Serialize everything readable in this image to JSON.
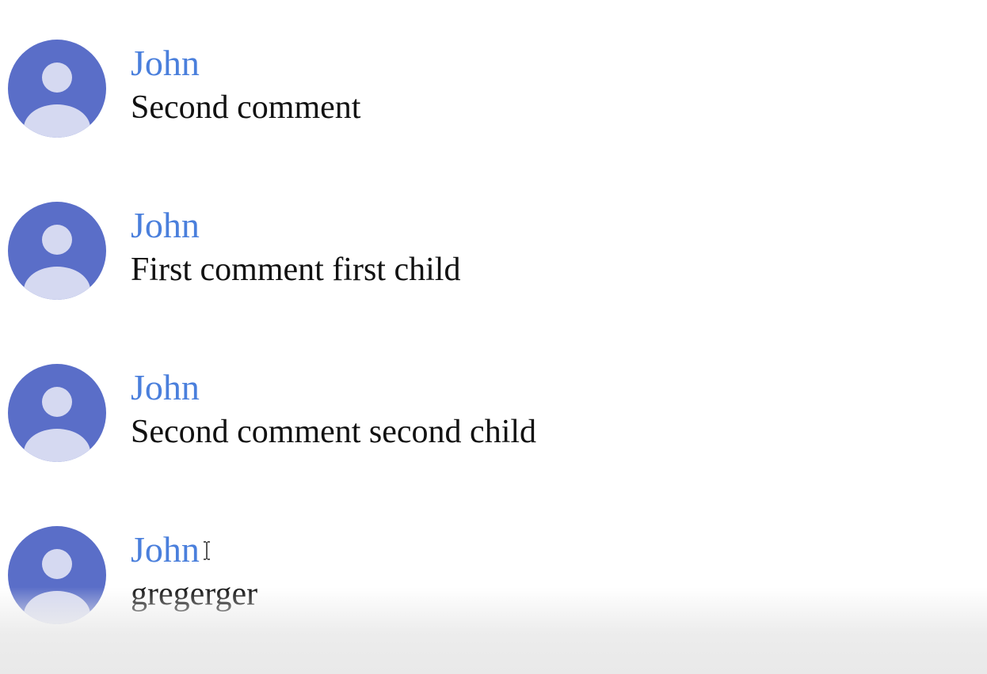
{
  "colors": {
    "author": "#4a7fdc",
    "avatar_bg": "#5a6ec8",
    "avatar_fg": "#d5d9f1",
    "text": "#111111"
  },
  "comments": [
    {
      "author": "John",
      "text": "Second comment",
      "avatar_icon": "user-avatar-icon"
    },
    {
      "author": "John",
      "text": "First comment first child",
      "avatar_icon": "user-avatar-icon"
    },
    {
      "author": "John",
      "text": "Second comment second child",
      "avatar_icon": "user-avatar-icon"
    },
    {
      "author": "John",
      "text": "gregerger",
      "avatar_icon": "user-avatar-icon"
    }
  ],
  "cursor": {
    "icon": "text-cursor-icon"
  }
}
